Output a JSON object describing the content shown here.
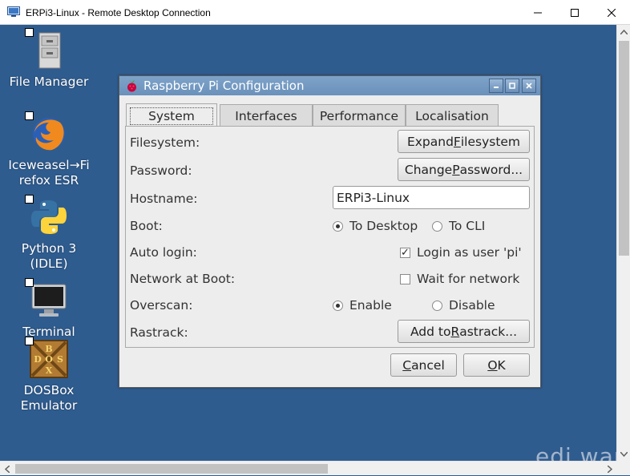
{
  "window": {
    "title": "ERPi3-Linux - Remote Desktop Connection",
    "minimize": "minimize",
    "maximize": "maximize",
    "close": "close"
  },
  "desktop": {
    "icons": [
      {
        "label": "File Manager",
        "icon": "file-cabinet-icon"
      },
      {
        "label": "Iceweasel→Fi\nrefox ESR",
        "icon": "firefox-icon"
      },
      {
        "label": "Python 3\n(IDLE)",
        "icon": "python-icon"
      },
      {
        "label": "Terminal",
        "icon": "monitor-icon"
      },
      {
        "label": "DOSBox\nEmulator",
        "icon": "dosbox-icon"
      }
    ],
    "dosbox_letters": [
      "B",
      "D",
      "O",
      "S",
      "X"
    ]
  },
  "dialog": {
    "title": "Raspberry Pi Configuration",
    "tabs": [
      "System",
      "Interfaces",
      "Performance",
      "Localisation"
    ],
    "active_tab": "System",
    "rows": {
      "filesystem": {
        "label": "Filesystem:",
        "button_pre": "Expand ",
        "button_mn": "F",
        "button_post": "ilesystem"
      },
      "password": {
        "label": "Password:",
        "button_pre": "Change ",
        "button_mn": "P",
        "button_post": "assword..."
      },
      "hostname": {
        "label": "Hostname:",
        "value": "ERPi3-Linux"
      },
      "boot": {
        "label": "Boot:",
        "option1": "To Desktop",
        "option2": "To CLI",
        "selected": "To Desktop"
      },
      "autologin": {
        "label": "Auto login:",
        "option": "Login as user 'pi'",
        "checked": true
      },
      "network": {
        "label": "Network at Boot:",
        "option": "Wait for network",
        "checked": false
      },
      "overscan": {
        "label": "Overscan:",
        "option1": "Enable",
        "option2": "Disable",
        "selected": "Enable"
      },
      "rastrack": {
        "label": "Rastrack:",
        "button_pre": "Add to ",
        "button_mn": "R",
        "button_post": "astrack..."
      }
    },
    "cancel": {
      "mn": "C",
      "rest": "ancel"
    },
    "ok": {
      "mn": "O",
      "rest": "K"
    }
  },
  "watermark": "edi.wang",
  "colors": {
    "desktop": "#2f5c8f",
    "titlebar": "#7ea3c9",
    "dialog_bg": "#ededed"
  }
}
